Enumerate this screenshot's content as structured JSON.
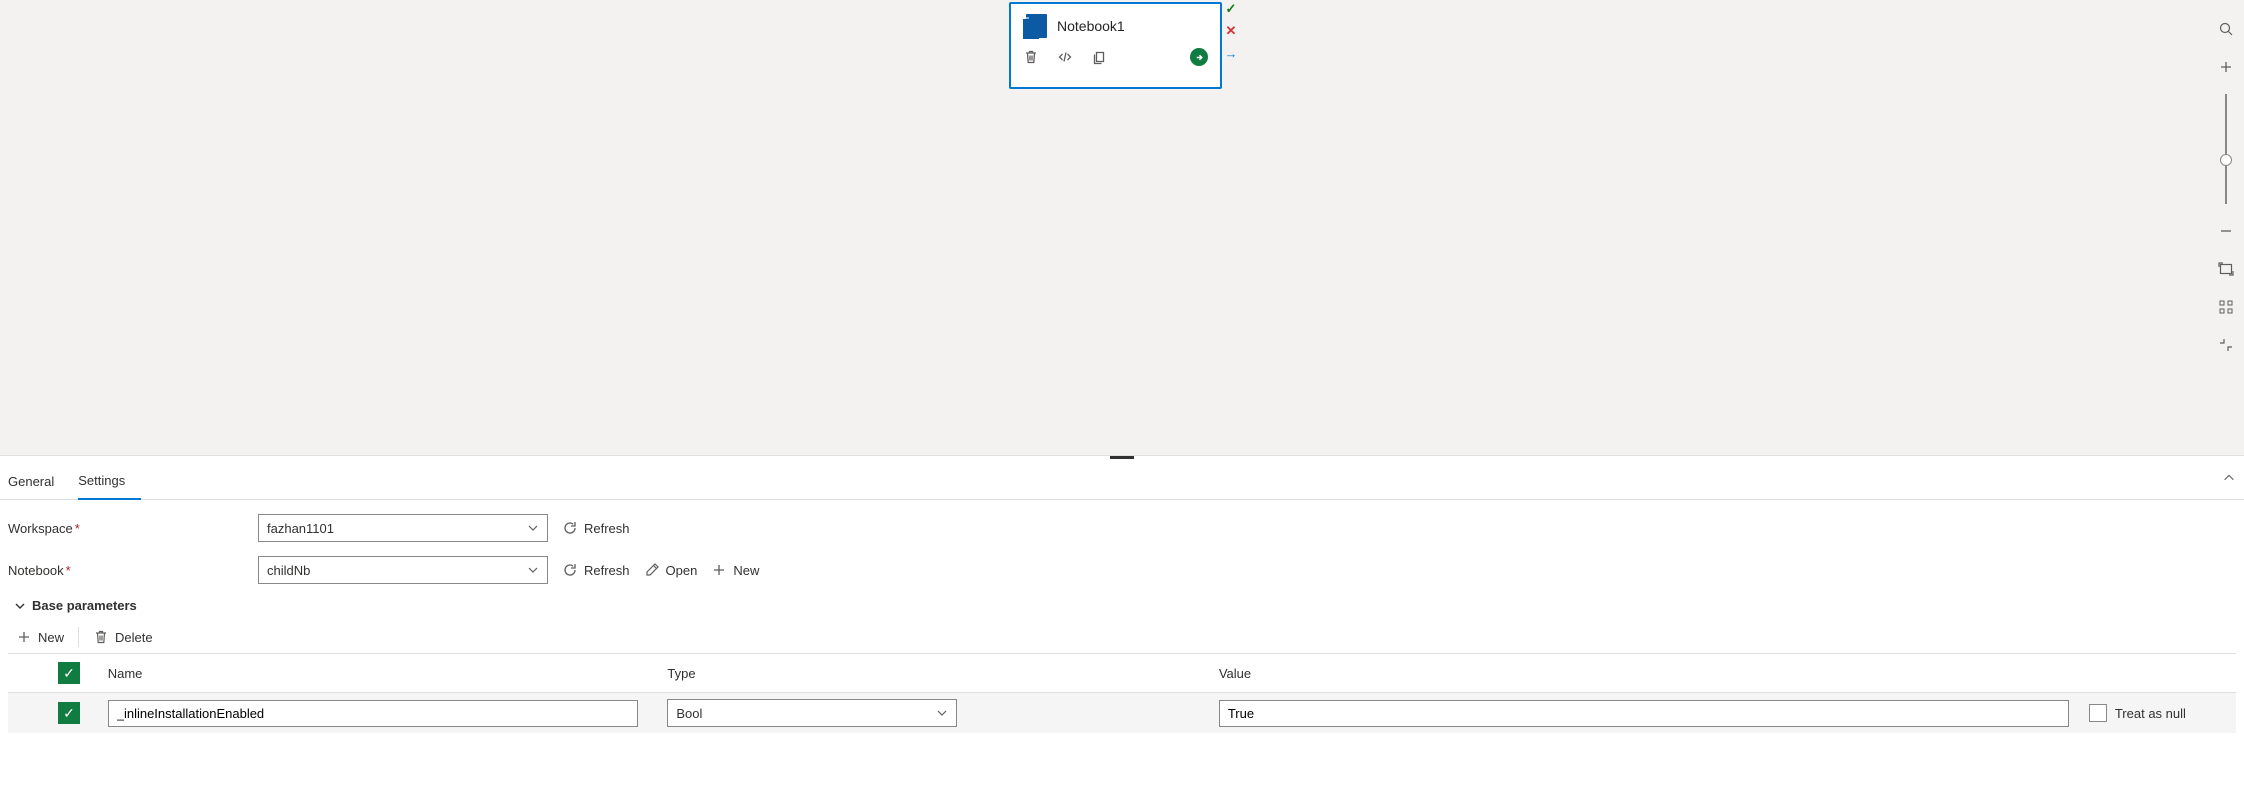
{
  "node": {
    "title": "Notebook1"
  },
  "tabs": {
    "general": "General",
    "settings": "Settings"
  },
  "form": {
    "workspace_label": "Workspace",
    "workspace_value": "fazhan1101",
    "notebook_label": "Notebook",
    "notebook_value": "childNb",
    "refresh": "Refresh",
    "open": "Open",
    "new": "New"
  },
  "section": {
    "base_params": "Base parameters"
  },
  "toolbar": {
    "new": "New",
    "delete": "Delete"
  },
  "table": {
    "headers": {
      "name": "Name",
      "type": "Type",
      "value": "Value"
    },
    "row": {
      "name": "_inlineInstallationEnabled",
      "type": "Bool",
      "value": "True",
      "null_label": "Treat as null"
    }
  }
}
